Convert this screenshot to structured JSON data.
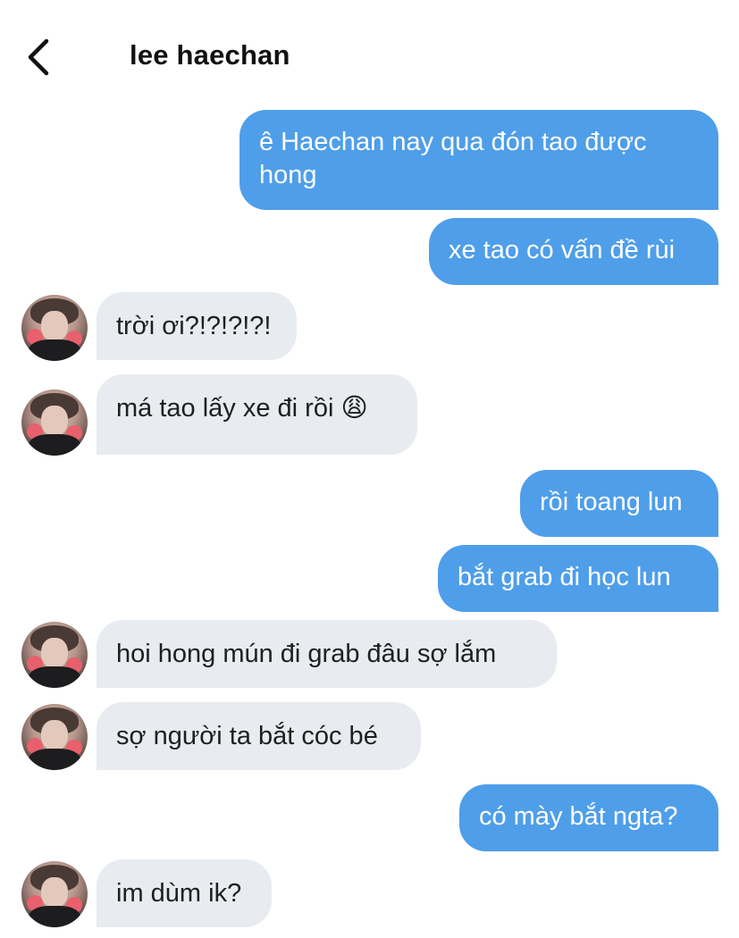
{
  "header": {
    "title": "lee haechan"
  },
  "messages": [
    {
      "text": "ê Haechan nay qua đón tao được hong"
    },
    {
      "text": "xe tao có vấn đề rùi"
    },
    {
      "text": "trời ơi?!?!?!?!"
    },
    {
      "text": "má tao lấy xe đi rồi 😩"
    },
    {
      "text": "rồi toang lun"
    },
    {
      "text": "bắt grab đi học lun"
    },
    {
      "text": "hoi hong mún đi grab đâu sợ lắm"
    },
    {
      "text": "sợ người ta bắt cóc bé"
    },
    {
      "text": "có mày bắt ngta?"
    },
    {
      "text": "im dùm ik?"
    }
  ],
  "colors": {
    "outgoing_bubble": "#4f9ee9",
    "incoming_bubble": "#e8ebef",
    "background": "#ffffff"
  },
  "icons": {
    "back": "chevron-left-icon"
  }
}
